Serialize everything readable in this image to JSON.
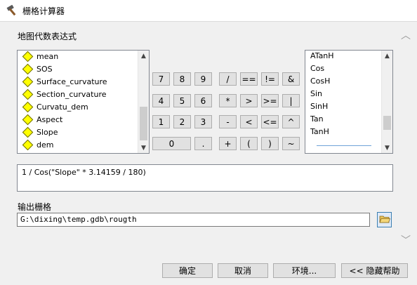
{
  "window": {
    "title": "栅格计算器",
    "icon": "hammer-icon"
  },
  "map_algebra": {
    "label": "地图代数表达式",
    "layers": [
      "mean",
      "SOS",
      "Surface_curvature",
      "Section_curvature",
      "Curvatu_dem",
      "Aspect",
      "Slope",
      "dem"
    ],
    "layer_icon": "raster-layer-diamond-icon"
  },
  "keypad": {
    "rows": [
      [
        "7",
        "8",
        "9",
        "/",
        "==",
        "!=",
        "&"
      ],
      [
        "4",
        "5",
        "6",
        "*",
        ">",
        ">=",
        "|"
      ],
      [
        "1",
        "2",
        "3",
        "-",
        "<",
        "<=",
        "^"
      ],
      [
        "0",
        ".",
        "+",
        "(",
        ")",
        "~"
      ]
    ]
  },
  "functions": [
    "ATanH",
    "Cos",
    "CosH",
    "Sin",
    "SinH",
    "Tan",
    "TanH"
  ],
  "expression": {
    "value": "1 / Cos(\"Slope\" * 3.14159 / 180)"
  },
  "output": {
    "label": "输出栅格",
    "value": "G:\\dixing\\temp.gdb\\rougth",
    "browse_icon": "open-folder-icon"
  },
  "buttons": {
    "ok": "确定",
    "cancel": "取消",
    "env": "环境...",
    "hide_help": "<< 隐藏帮助"
  },
  "colors": {
    "layer_diamond": "#ffff00",
    "panel_bg": "#f0f0f0",
    "folder_button_border": "#3c7fb1"
  }
}
